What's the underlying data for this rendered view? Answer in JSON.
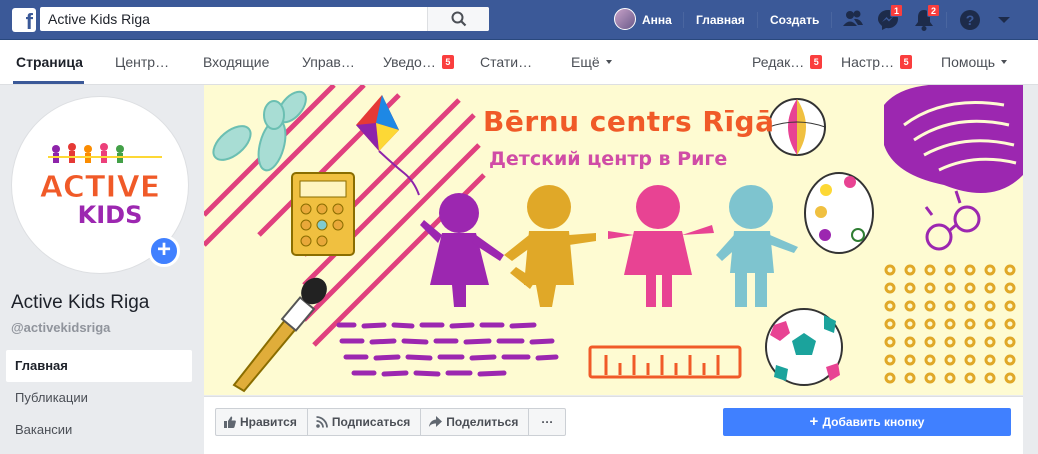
{
  "topbar": {
    "search_value": "Active Kids Riga",
    "user_name": "Анна",
    "home_label": "Главная",
    "create_label": "Создать",
    "messenger_badge": "1",
    "notifications_badge": "2",
    "brand_color": "#3b5998"
  },
  "page_nav": {
    "items": [
      {
        "label": "Страница"
      },
      {
        "label": "Центр…"
      },
      {
        "label": "Входящие"
      },
      {
        "label": "Управ…"
      },
      {
        "label": "Уведо…",
        "badge": "5"
      },
      {
        "label": "Стати…"
      },
      {
        "label": "Ещё"
      },
      {
        "label": "Редак…",
        "badge": "5"
      },
      {
        "label": "Настр…",
        "badge": "5"
      },
      {
        "label": "Помощь"
      }
    ]
  },
  "profile": {
    "logo_word1": "ACTIVE",
    "logo_word2": "KIDS",
    "name": "Active Kids Riga",
    "handle": "@activekidsriga"
  },
  "side_nav": {
    "items": [
      {
        "label": "Главная"
      },
      {
        "label": "Публикации"
      },
      {
        "label": "Вакансии"
      }
    ]
  },
  "cover": {
    "title": "Bērnu centrs Rīgā",
    "subtitle": "Детский центр в Риге"
  },
  "actions": {
    "like": "Нравится",
    "follow": "Подписаться",
    "share": "Поделиться",
    "more": "···",
    "add_button": "Добавить кнопку",
    "accent_color": "#4080ff"
  }
}
